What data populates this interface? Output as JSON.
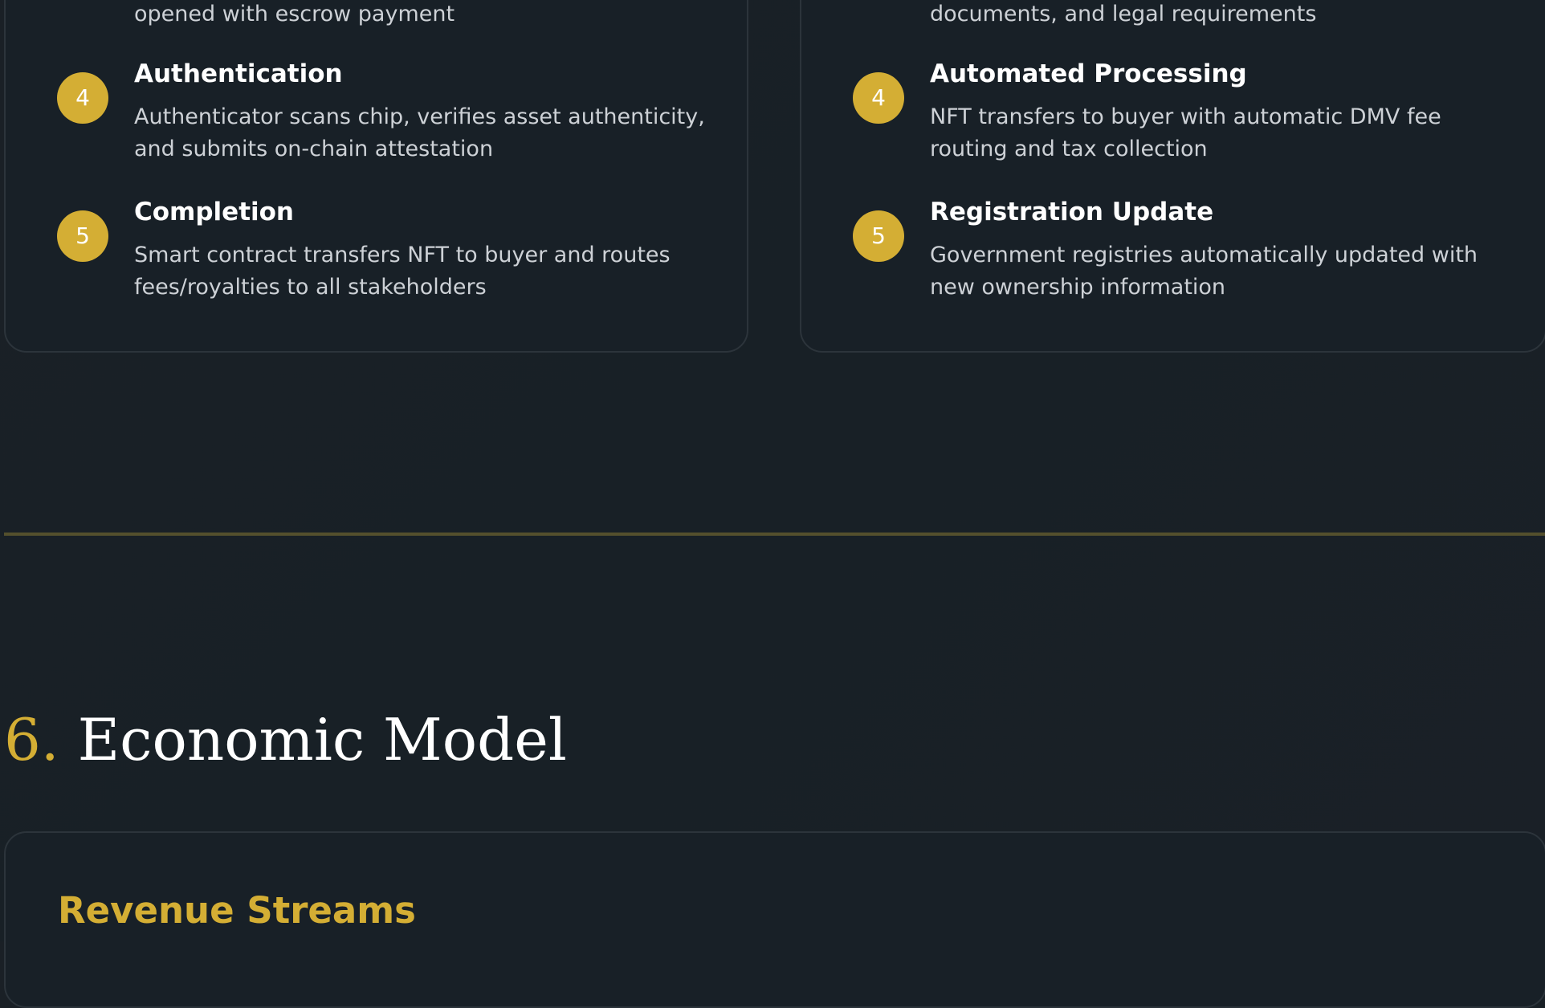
{
  "left_card": {
    "trailing_text": "opened with escrow payment",
    "steps": [
      {
        "num": "4",
        "title": "Authentication",
        "desc": "Authenticator scans chip, verifies asset authenticity, and submits on-chain attestation"
      },
      {
        "num": "5",
        "title": "Completion",
        "desc": "Smart contract transfers NFT to buyer and routes fees/royalties to all stakeholders"
      }
    ]
  },
  "right_card": {
    "trailing_text": "documents, and legal requirements",
    "steps": [
      {
        "num": "4",
        "title": "Automated Processing",
        "desc": "NFT transfers to buyer with automatic DMV fee routing and tax collection"
      },
      {
        "num": "5",
        "title": "Registration Update",
        "desc": "Government registries automatically updated with new ownership information"
      }
    ]
  },
  "section": {
    "number": "6.",
    "title": "Economic Model"
  },
  "economic_card": {
    "heading": "Revenue Streams"
  },
  "colors": {
    "accent": "#d4ae34",
    "background": "#182027",
    "card_border": "#2c343b",
    "divider": "#54502d"
  }
}
